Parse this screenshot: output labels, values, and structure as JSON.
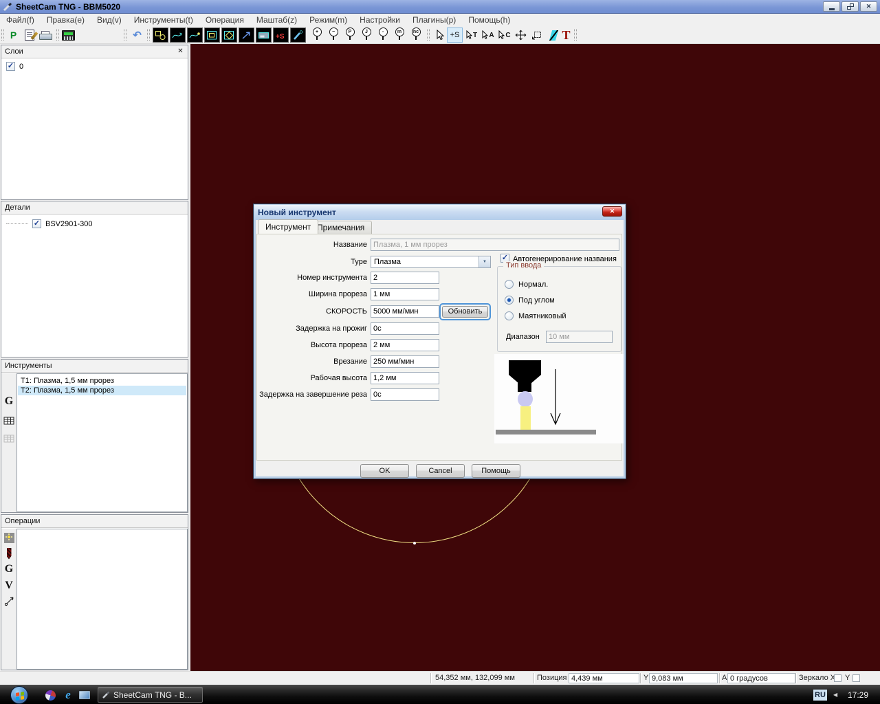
{
  "window": {
    "title": "SheetCam TNG - BBM5020",
    "menu": [
      "Файл(f)",
      "Правка(e)",
      "Вид(v)",
      "Инструменты(t)",
      "Операция",
      "Маштаб(z)",
      "Режим(m)",
      "Настройки",
      "Плагины(p)",
      "Помощь(h)"
    ]
  },
  "toolbar": {
    "p": "P",
    "s_plus": "+S",
    "t_red": "T",
    "zoom_glyphs": [
      "+",
      "−",
      "P",
      "J",
      "▫",
      "m",
      "nc"
    ],
    "cursor_letters": [
      "T",
      "A",
      "C"
    ]
  },
  "glyphs": {
    "check": "✓",
    "close": "✕",
    "dropdown": "▼",
    "undo": "↶",
    "tray_left": "◀"
  },
  "panels": {
    "layers": {
      "title": "Слои",
      "item": "0"
    },
    "parts": {
      "title": "Детали",
      "item": "BSV2901-300"
    },
    "tools": {
      "title": "Инструменты",
      "items": [
        "T1: Плазма, 1,5 мм прорез",
        "T2: Плазма, 1,5 мм прорез"
      ],
      "strip_g": "G"
    },
    "operations": {
      "title": "Операции",
      "strip_g": "G",
      "strip_v": "V"
    }
  },
  "dialog": {
    "title": "Новый инструмент",
    "tabs": [
      "Инструмент",
      "Примечания"
    ],
    "fields": [
      {
        "label": "Название",
        "value": "Плазма, 1 мм прорез"
      },
      {
        "label": "Type",
        "value": "Плазма"
      },
      {
        "label": "Номер инструмента",
        "value": "2"
      },
      {
        "label": "Ширина прореза",
        "value": "1 мм"
      },
      {
        "label": "СКОРОСТЬ",
        "value": "5000 мм/мин",
        "button": "Обновить"
      },
      {
        "label": "Задержка на прожиг",
        "value": "0с"
      },
      {
        "label": "Высота прореза",
        "value": "2 мм"
      },
      {
        "label": "Врезание",
        "value": "250 мм/мин"
      },
      {
        "label": "Рабочая высота",
        "value": "1,2 мм"
      },
      {
        "label": "Задержка на завершение реза",
        "value": "0с"
      }
    ],
    "autogen_label": "Автогенерирование названия",
    "input_type": {
      "title": "Тип ввода",
      "options": [
        "Нормал.",
        "Под углом",
        "Маятниковый"
      ],
      "selected": "Под углом",
      "range_label": "Диапазон",
      "range_value": "10 мм"
    },
    "buttons": {
      "ok": "OK",
      "cancel": "Cancel",
      "help": "Помощь"
    }
  },
  "statusbar": {
    "coords": "54,352 мм, 132,099 мм",
    "pos_label": "Позиция X",
    "x_value": "4,439 мм",
    "y_label": "Y",
    "y_value": "9,083 мм",
    "a_label": "А",
    "a_value": "0 градусов",
    "mirror_x_label": "Зеркало X",
    "mirror_y_label": "Y"
  },
  "taskbar": {
    "app_button": "SheetCam TNG - B...",
    "lang": "RU",
    "time": "17:29"
  },
  "colors": {
    "canvas_bg": "#3F0608",
    "toolpath_yellow": "#EDDC82",
    "selection_blue": "#CFE9F9",
    "group_title": "#8B3A2E"
  }
}
